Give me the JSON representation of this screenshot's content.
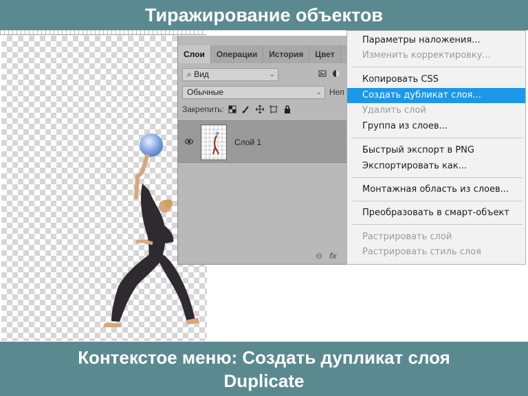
{
  "slide": {
    "title": "Тиражирование объектов",
    "caption_line1": "Контекстое меню:  Создать дупликат слоя",
    "caption_line2": "Duplicate"
  },
  "layers_panel": {
    "tabs": [
      "Слои",
      "Операции",
      "История",
      "Цвет"
    ],
    "filter_label": "Вид",
    "blend_mode": "Обычные",
    "opacity_label_partial": "Неп",
    "lock_label": "Закрепить:",
    "layer_name": "Слой 1",
    "footer_links": "fx"
  },
  "context_menu": {
    "items": [
      {
        "label": "Параметры наложения...",
        "state": "enabled"
      },
      {
        "label": "Изменить корректировку...",
        "state": "disabled"
      },
      {
        "label": "Копировать CSS",
        "state": "enabled"
      },
      {
        "label": "Создать дубликат слоя...",
        "state": "highlighted"
      },
      {
        "label": "Удалить слой",
        "state": "disabled"
      },
      {
        "label": "Группа из слоев...",
        "state": "enabled"
      },
      {
        "label": "Быстрый экспорт в PNG",
        "state": "enabled"
      },
      {
        "label": "Экспортировать как...",
        "state": "enabled"
      },
      {
        "label": "Монтажная область из слоев...",
        "state": "enabled"
      },
      {
        "label": "Преобразовать в смарт-объект",
        "state": "enabled"
      },
      {
        "label": "Растрировать слой",
        "state": "disabled"
      },
      {
        "label": "Растрировать стиль слоя",
        "state": "disabled"
      }
    ]
  },
  "colors": {
    "banner": "#5a8a90",
    "menu_highlight": "#1c97ea"
  }
}
